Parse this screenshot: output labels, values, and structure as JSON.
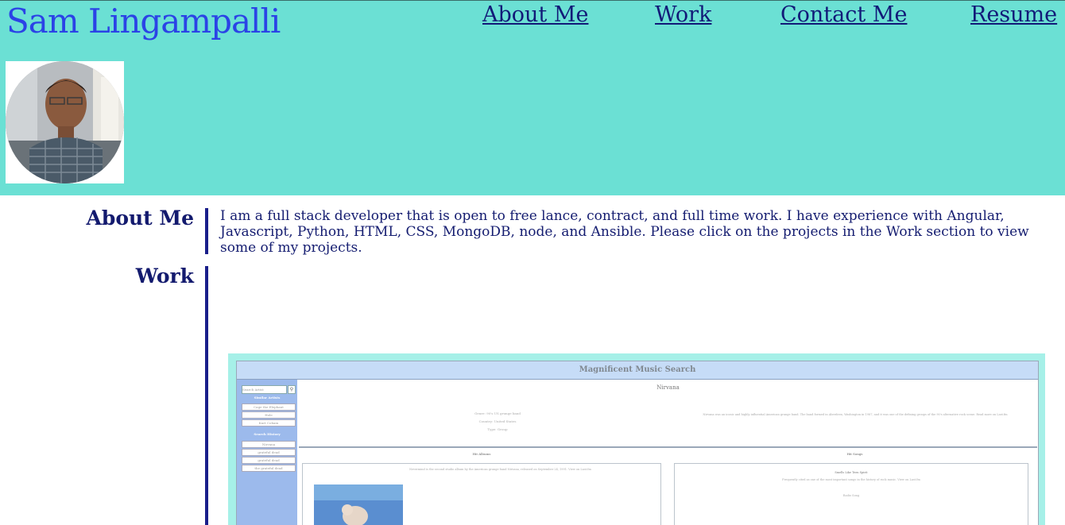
{
  "header": {
    "site_name": "Sam Lingampalli",
    "nav": [
      "About Me",
      "Work",
      "Contact Me",
      "Resume"
    ],
    "bg_color": "#6be0d4",
    "name_color": "#2b43e6"
  },
  "about": {
    "heading": "About Me",
    "text": "I am a full stack developer that is open to free lance, contract, and full time work. I have experience with Angular, Javascript, Python, HTML, CSS, MongoDB, node, and Ansible. Please click on the projects in the Work section to view some of my projects."
  },
  "work": {
    "heading": "Work",
    "project": {
      "app_title": "Magnificent Music Search",
      "search_placeholder": "Search Artist",
      "similar_heading": "Similar Artists",
      "similar": [
        "Cage the Elephant",
        "Hole",
        "Kurt Cobain"
      ],
      "history_heading": "Search History",
      "history": [
        "Nirvana",
        "grateful dead",
        "grateful dead",
        "the grateful dead"
      ],
      "artist": "Nirvana",
      "info": [
        "Genre: 90's US grunge band",
        "Country: United States",
        "Type: Group"
      ],
      "bio": "Nirvana was an iconic and highly influential American grunge band. The band formed in Aberdeen, Washington in 1987, and it was one of the defining groups of the 90's alternative rock scene. Read more on Last.fm",
      "albums_heading": "Hit Albums",
      "songs_heading": "Hit Songs",
      "album_text": "Nevermind is the second studio album by the American grunge band Nirvana, released on September 24, 1991. View on Last.fm",
      "song_title": "Smells Like Teen Spirit",
      "song_text": "Frequently cited as one of the most important songs in the history of rock music. View on Last.fm",
      "lyrics_label": "Radio Song"
    }
  }
}
